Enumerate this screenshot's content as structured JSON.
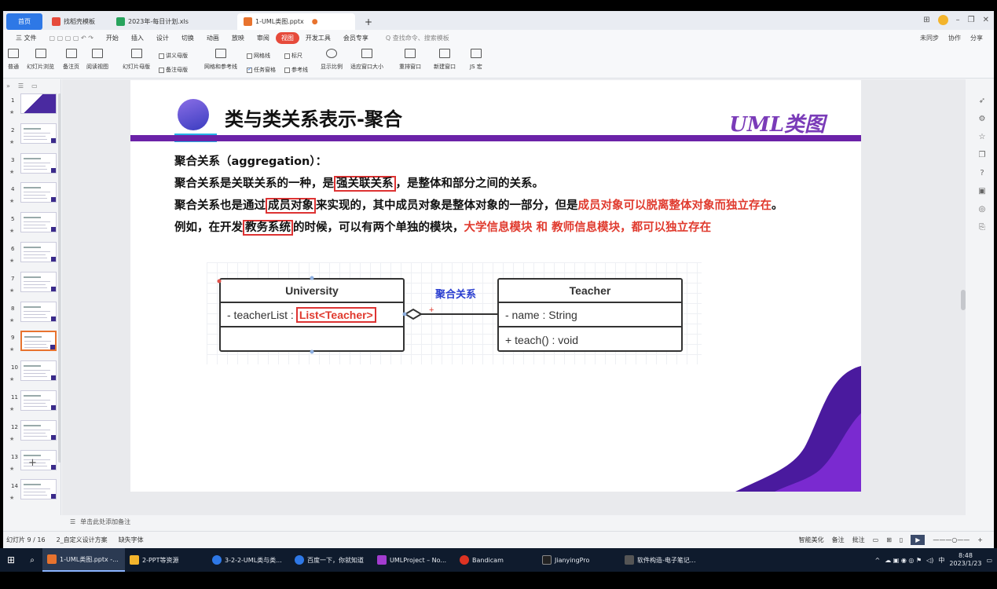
{
  "titlebar": {
    "home_tab": "首页",
    "tabs": [
      {
        "label": "找稻壳模板",
        "color": "#e64a3b"
      },
      {
        "label": "2023年-每日计划.xls",
        "color": "#27a35c"
      },
      {
        "label": "1-UML类图.pptx",
        "color": "#e8732e"
      }
    ]
  },
  "menubar": {
    "file": "三 文件",
    "items": [
      "开始",
      "插入",
      "设计",
      "切换",
      "动画",
      "放映",
      "审阅",
      "视图",
      "开发工具",
      "会员专享"
    ],
    "selected": "视图",
    "search": "Q 查找命令、搜索模板",
    "right": [
      "未同步",
      "协作",
      "分享"
    ]
  },
  "ribbon": {
    "big_buttons": [
      "普通",
      "幻灯片浏览",
      "备注页",
      "阅读视图",
      "幻灯片母版",
      "网格和参考线",
      "显示比例",
      "适应窗口大小",
      "重排窗口",
      "新建窗口",
      "JS 宏"
    ],
    "small": {
      "handout_master": "讲义母版",
      "notes_master": "备注母版",
      "gridlines": "网格线",
      "ruler": "标尺",
      "task_pane": "任务窗格",
      "guides": "参考线"
    }
  },
  "thumbnails": {
    "count": 14,
    "selected": 9,
    "numbers": [
      "1",
      "2",
      "3",
      "4",
      "5",
      "6",
      "7",
      "8",
      "9",
      "10",
      "11",
      "12",
      "13",
      "14"
    ]
  },
  "slide": {
    "title": "类与类关系表示-聚合",
    "tag": "UML类图",
    "line1": "聚合关系（aggregation）：",
    "line2": {
      "a": "聚合关系是关联关系的一种，是",
      "boxed": "强关联关系",
      "b": "，是整体和部分之间的关系。"
    },
    "line3": {
      "a": "聚合关系也是通过",
      "boxed": "成员对象",
      "b": "来实现的，其中成员对象是整体对象的一部分，但是",
      "red": "成员对象可以脱离整体对象而独立存在",
      "c": "。"
    },
    "line4": {
      "a": "例如，在开发",
      "boxed": "教务系统",
      "b": "的时候，可以有两个单独的模块，",
      "red": "大学信息模块 和 教师信息模块，都可以独立存在"
    },
    "diagram": {
      "assoc_label": "聚合关系",
      "university": {
        "name": "University",
        "attr_prefix": "- teacherList :",
        "attr_type": "List<Teacher>"
      },
      "teacher": {
        "name": "Teacher",
        "attr": "- name : String",
        "method": "+ teach() : void"
      }
    }
  },
  "notes": "单击此处添加备注",
  "statusbar": {
    "slide_info": "幻灯片 9 / 16",
    "theme": "2_自定义设计方案",
    "missing_fonts": "缺失字体",
    "smart_beautify": "智能美化",
    "notes_btn": "备注",
    "comments_btn": "批注"
  },
  "taskbar": {
    "items": [
      {
        "label": "1-UML类图.pptx -...",
        "color": "#e8732e"
      },
      {
        "label": "2-PPT等资源",
        "color": "#f3b42c"
      },
      {
        "label": "3-2-2-UML类与类...",
        "color": "#2e78e6"
      },
      {
        "label": "百度一下，你就知道",
        "color": "#2e78e6"
      },
      {
        "label": "UMLProject – No...",
        "color": "#a33ccf"
      },
      {
        "label": "Bandicam",
        "color": "#d32"
      },
      {
        "label": "JianyingPro",
        "color": "#222"
      },
      {
        "label": "软件构造-电子笔记...",
        "color": "#555"
      }
    ],
    "ime": "中",
    "time": "8:48",
    "date": "2023/1/23"
  }
}
